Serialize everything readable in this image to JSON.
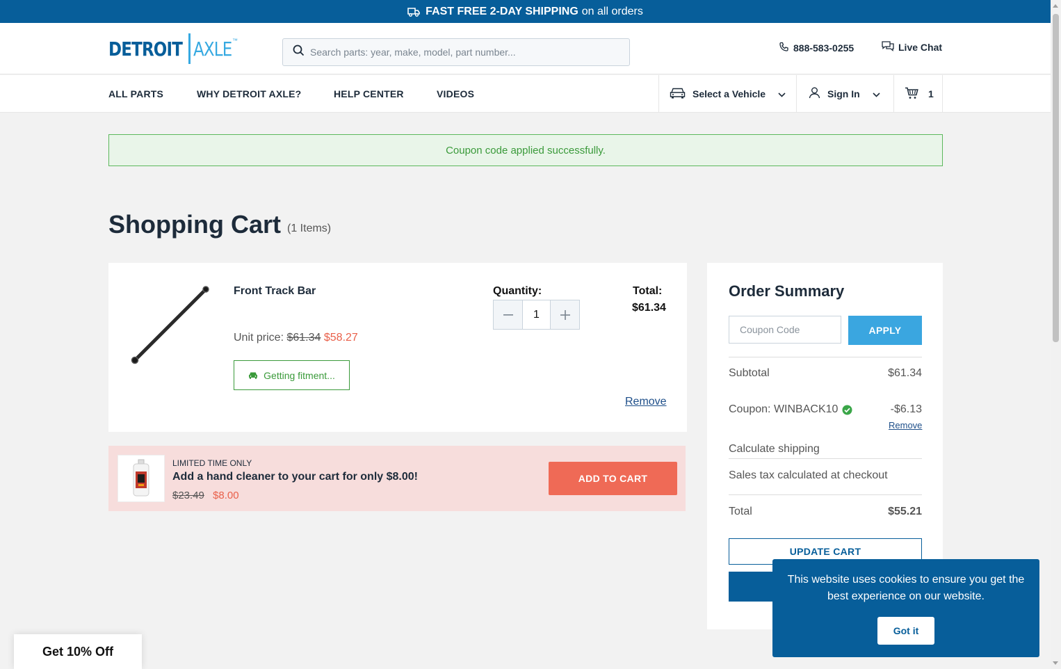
{
  "topbar": {
    "bold": "FAST FREE 2-DAY SHIPPING",
    "rest": "on all orders",
    "icon": "truck-icon"
  },
  "header": {
    "logo_left": "DETROIT",
    "logo_right": "AXLE",
    "logo_tm": "™",
    "search_placeholder": "Search parts: year, make, model, part number...",
    "phone": "888-583-0255",
    "chat": "Live Chat"
  },
  "nav": {
    "links": [
      "ALL PARTS",
      "WHY DETROIT AXLE?",
      "HELP CENTER",
      "VIDEOS"
    ],
    "vehicle": "Select a Vehicle",
    "signin": "Sign In",
    "cart_count": "1"
  },
  "alert": {
    "text": "Coupon code applied successfully."
  },
  "cart": {
    "title": "Shopping Cart",
    "count": "(1 Items)",
    "item": {
      "name": "Front Track Bar",
      "unit_label": "Unit price:",
      "old_price": "$61.34",
      "new_price": "$58.27",
      "fitment": "Getting fitment...",
      "qty_label": "Quantity:",
      "qty": "1",
      "total_label": "Total:",
      "total": "$61.34",
      "remove": "Remove"
    }
  },
  "promo": {
    "tag": "LIMITED TIME ONLY",
    "message": "Add a hand cleaner to your cart for only $8.00!",
    "old_price": "$23.49",
    "new_price": "$8.00",
    "button": "ADD TO CART"
  },
  "summary": {
    "title": "Order Summary",
    "coupon_placeholder": "Coupon Code",
    "apply": "APPLY",
    "subtotal_label": "Subtotal",
    "subtotal": "$61.34",
    "coupon_label": "Coupon: WINBACK10",
    "coupon_value": "-$6.13",
    "coupon_remove": "Remove",
    "shipping": "Calculate shipping",
    "tax": "Sales tax calculated at checkout",
    "total_label": "Total",
    "total": "$55.21",
    "update": "UPDATE CART"
  },
  "cookie": {
    "message": "This website uses cookies to ensure you get the best experience on our website.",
    "button": "Got it"
  },
  "offer": {
    "text": "Get 10% Off"
  },
  "colors": {
    "brand": "#075e9a",
    "accent": "#36a9e1",
    "sale": "#e9604a",
    "success": "#3a9a3a"
  }
}
